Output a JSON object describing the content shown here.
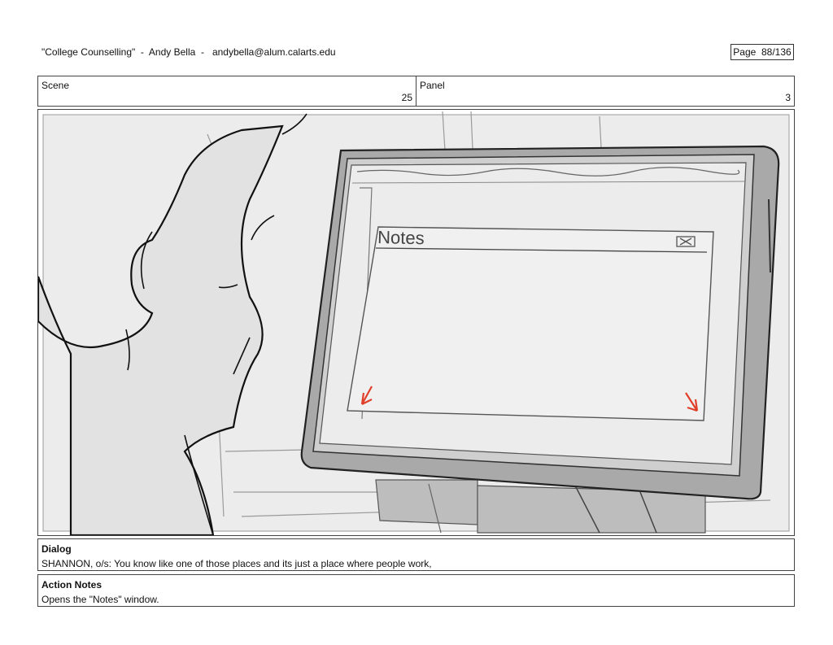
{
  "header": {
    "title": "\"College Counselling\"  -  Andy Bella  -   andybella@alum.calarts.edu",
    "page_label": "Page  88/136"
  },
  "scene": {
    "label": "Scene",
    "value": "25"
  },
  "panel": {
    "label": "Panel",
    "value": "3"
  },
  "drawing": {
    "window_title": "Notes",
    "arrow_color": "#e0402a"
  },
  "dialog": {
    "label": "Dialog",
    "text": "SHANNON, o/s: You know like one of those places and its just a place where people work,"
  },
  "action_notes": {
    "label": "Action Notes",
    "text": "Opens the \"Notes\" window."
  }
}
